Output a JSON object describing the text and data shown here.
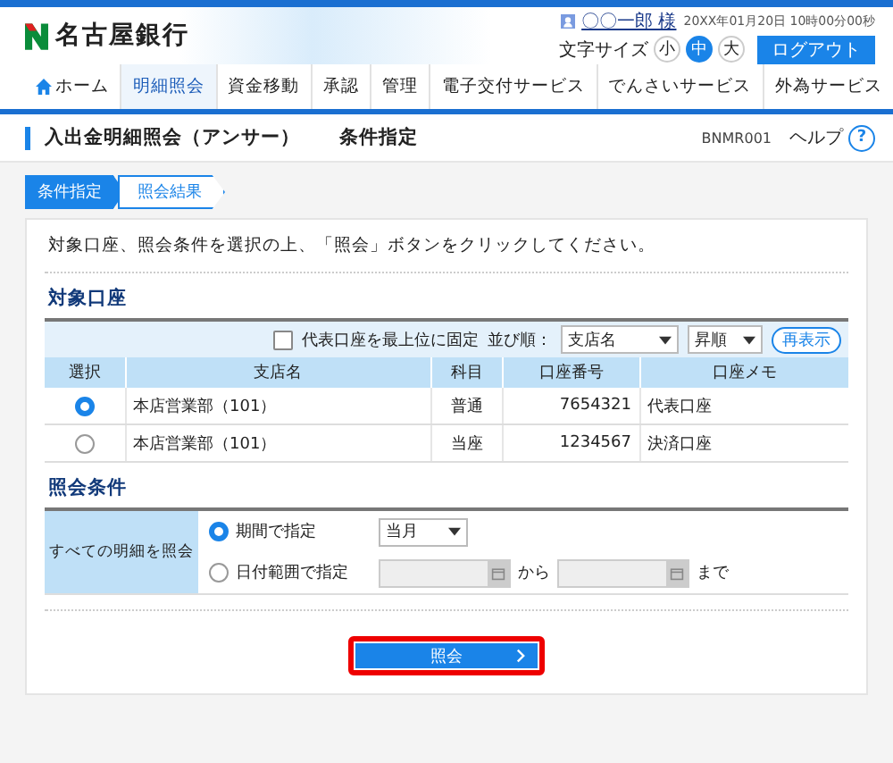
{
  "header": {
    "bank_name": "名古屋銀行",
    "user_name": "〇〇一郎 様",
    "datetime": "20XX年01月20日 10時00分00秒",
    "font_size_label": "文字サイズ",
    "font_sizes": [
      {
        "label": "小",
        "selected": false
      },
      {
        "label": "中",
        "selected": true
      },
      {
        "label": "大",
        "selected": false
      }
    ],
    "logout": "ログアウト"
  },
  "nav": [
    {
      "label": "ホーム",
      "kind": "home",
      "selected": false
    },
    {
      "label": "明細照会",
      "kind": "menu",
      "selected": true
    },
    {
      "label": "資金移動",
      "kind": "menu",
      "selected": false
    },
    {
      "label": "承認",
      "kind": "menu",
      "selected": false
    },
    {
      "label": "管理",
      "kind": "menu",
      "selected": false
    },
    {
      "label": "電子交付サービス",
      "kind": "menu",
      "selected": false
    },
    {
      "label": "でんさいサービス",
      "kind": "menu",
      "selected": false
    },
    {
      "label": "外為サービス",
      "kind": "menu",
      "selected": false
    }
  ],
  "page": {
    "title": "入出金明細照会（アンサー）",
    "subtitle": "条件指定",
    "screen_id": "BNMR001",
    "help": "ヘルプ",
    "help_icon": "?"
  },
  "steps": [
    {
      "label": "条件指定",
      "selected": true
    },
    {
      "label": "照会結果",
      "selected": false
    }
  ],
  "instruction": "対象口座、照会条件を選択の上、「照会」ボタンをクリックしてください。",
  "accounts": {
    "heading": "対象口座",
    "pin_label": "代表口座を最上位に固定",
    "pin_checked": false,
    "sort_label": "並び順：",
    "sort_value": "支店名",
    "order_value": "昇順",
    "refresh": "再表示",
    "columns": [
      "選択",
      "支店名",
      "科目",
      "口座番号",
      "口座メモ"
    ],
    "rows": [
      {
        "selected": true,
        "branch": "本店営業部（101）",
        "type": "普通",
        "number": "7654321",
        "memo": "代表口座"
      },
      {
        "selected": false,
        "branch": "本店営業部（101）",
        "type": "当座",
        "number": "1234567",
        "memo": "決済口座"
      }
    ]
  },
  "conditions": {
    "heading": "照会条件",
    "label": "すべての明細を照会",
    "options": [
      {
        "kind": "period",
        "label": "期間で指定",
        "selected": true,
        "value": "当月"
      },
      {
        "kind": "date_range",
        "label": "日付範囲で指定",
        "selected": false,
        "from": "から",
        "to": "まで"
      }
    ]
  },
  "submit": "照会"
}
